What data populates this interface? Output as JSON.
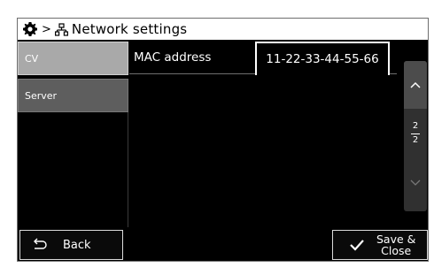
{
  "header": {
    "separator": ">",
    "title": "Network settings",
    "icons": {
      "settings": "gear-icon",
      "network": "network-icon"
    }
  },
  "sidebar": {
    "items": [
      {
        "label": "CV",
        "selected": true
      },
      {
        "label": "Server",
        "selected": false
      }
    ]
  },
  "main": {
    "mac_label": "MAC address",
    "mac_value": "11-22-33-44-55-66"
  },
  "scroller": {
    "current_page": "2",
    "total_pages": "2",
    "icons": {
      "up": "chevron-up-icon",
      "down": "chevron-down-icon"
    }
  },
  "footer": {
    "back_label": "Back",
    "save_label": "Save &\nClose",
    "icons": {
      "back": "return-arrow-icon",
      "save": "checkmark-icon"
    }
  },
  "colors": {
    "background": "#000000",
    "selected_nav": "#a9a9a9",
    "nav": "#5e5e5e",
    "title_bar": "#ffffff",
    "text": "#ffffff"
  }
}
